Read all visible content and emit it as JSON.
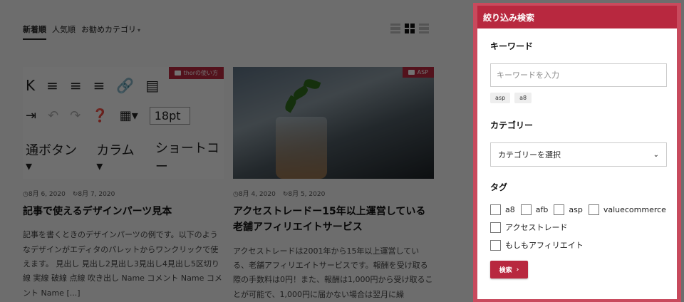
{
  "tabs": [
    {
      "label": "新着順",
      "active": true
    },
    {
      "label": "人気順",
      "active": false
    },
    {
      "label": "お勧めカテゴリ",
      "active": false
    }
  ],
  "view_icons": [
    "list-view-icon",
    "grid-view-icon",
    "rows-view-icon"
  ],
  "articles": [
    {
      "category": "thorの使い方",
      "editor_toolbar": {
        "row1": [
          "K",
          "≡",
          "≡",
          "≡",
          "🔗",
          "▤"
        ],
        "row2_size": "18pt",
        "row3": [
          "通ボタン ▾",
          "カラム ▾",
          "ショートコー"
        ]
      },
      "published": "8月 6, 2020",
      "updated": "8月 7, 2020",
      "title": "記事で使えるデザインパーツ見本",
      "excerpt": "記事を書くときのデザインパーツの例です。以下のようなデザインがエディタのパレットからワンクリックで使えます。 見出し 見出し2見出し3見出し4見出し5区切り線 実線 破線 点線 吹き出し Name コメント Name コメント Name [...]"
    },
    {
      "category": "ASP",
      "published": "8月 4, 2020",
      "updated": "8月 5, 2020",
      "title": "アクセストレードー15年以上運営している老舗アフィリエイトサービス",
      "excerpt": "アクセストレードは2001年から15年以上運営している、老舗アフィリエイトサービスです。報酬を受け取る際の手数料は0円！また、報酬は1,000円から受け取ることが可能で、1,000円に届かない場合は翌月に繰"
    }
  ],
  "modal": {
    "title": "絞り込み検索",
    "keyword_label": "キーワード",
    "keyword_placeholder": "キーワードを入力",
    "keyword_chips": [
      "asp",
      "a8"
    ],
    "category_label": "カテゴリー",
    "category_select": "カテゴリーを選択",
    "tag_label": "タグ",
    "tags_row1": [
      "a8",
      "afb",
      "asp",
      "valuecommerce"
    ],
    "tags_row2": "アクセストレード",
    "tags_row3": "もしもアフィリエイト",
    "submit_label": "検索"
  },
  "colors": {
    "accent": "#b8283f",
    "modal_frame": "#c84a5d"
  }
}
